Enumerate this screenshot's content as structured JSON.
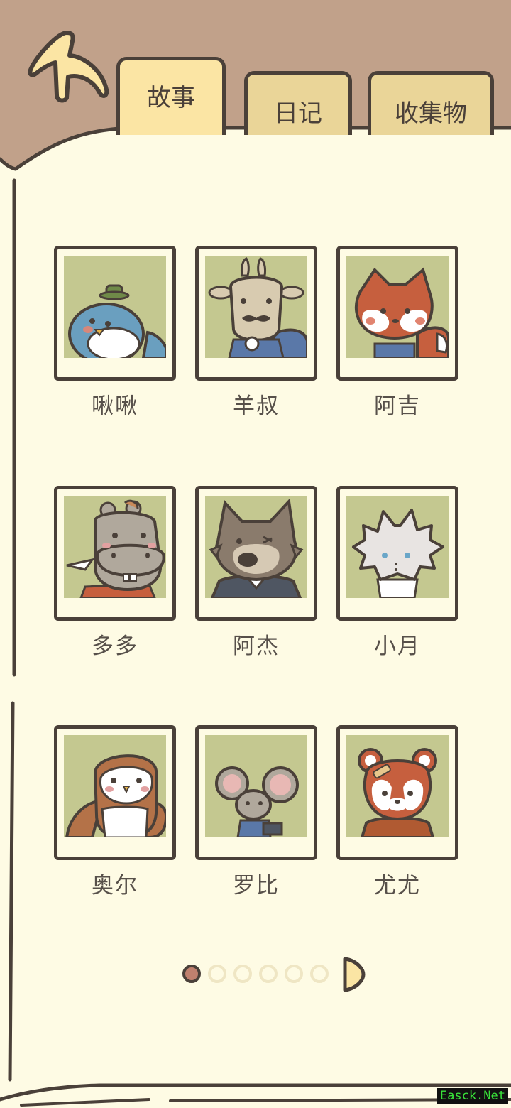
{
  "nav": {
    "back_icon": "back-arrow-icon",
    "tabs": [
      {
        "label": "故事",
        "active": true
      },
      {
        "label": "日记",
        "active": false
      },
      {
        "label": "收集物",
        "active": false
      }
    ]
  },
  "characters": [
    {
      "name": "啾啾",
      "icon": "blue-bird-portrait"
    },
    {
      "name": "羊叔",
      "icon": "goat-portrait"
    },
    {
      "name": "阿吉",
      "icon": "fox-portrait"
    },
    {
      "name": "多多",
      "icon": "hippo-portrait"
    },
    {
      "name": "阿杰",
      "icon": "wolf-portrait"
    },
    {
      "name": "小月",
      "icon": "white-cat-portrait"
    },
    {
      "name": "奥尔",
      "icon": "owl-portrait"
    },
    {
      "name": "罗比",
      "icon": "mouse-portrait"
    },
    {
      "name": "尤尤",
      "icon": "red-panda-portrait"
    }
  ],
  "pagination": {
    "current_page": 1,
    "total_pages": 6,
    "next_icon": "next-page-arrow-icon"
  },
  "colors": {
    "background_top": "#c1a18a",
    "page": "#fefbe4",
    "outline": "#4a4039",
    "tab": "#ead598",
    "tab_active": "#fbe5a4",
    "photo_bg": "#c4c890",
    "dot_active": "#c0806e"
  },
  "watermark": "Easck.Net"
}
